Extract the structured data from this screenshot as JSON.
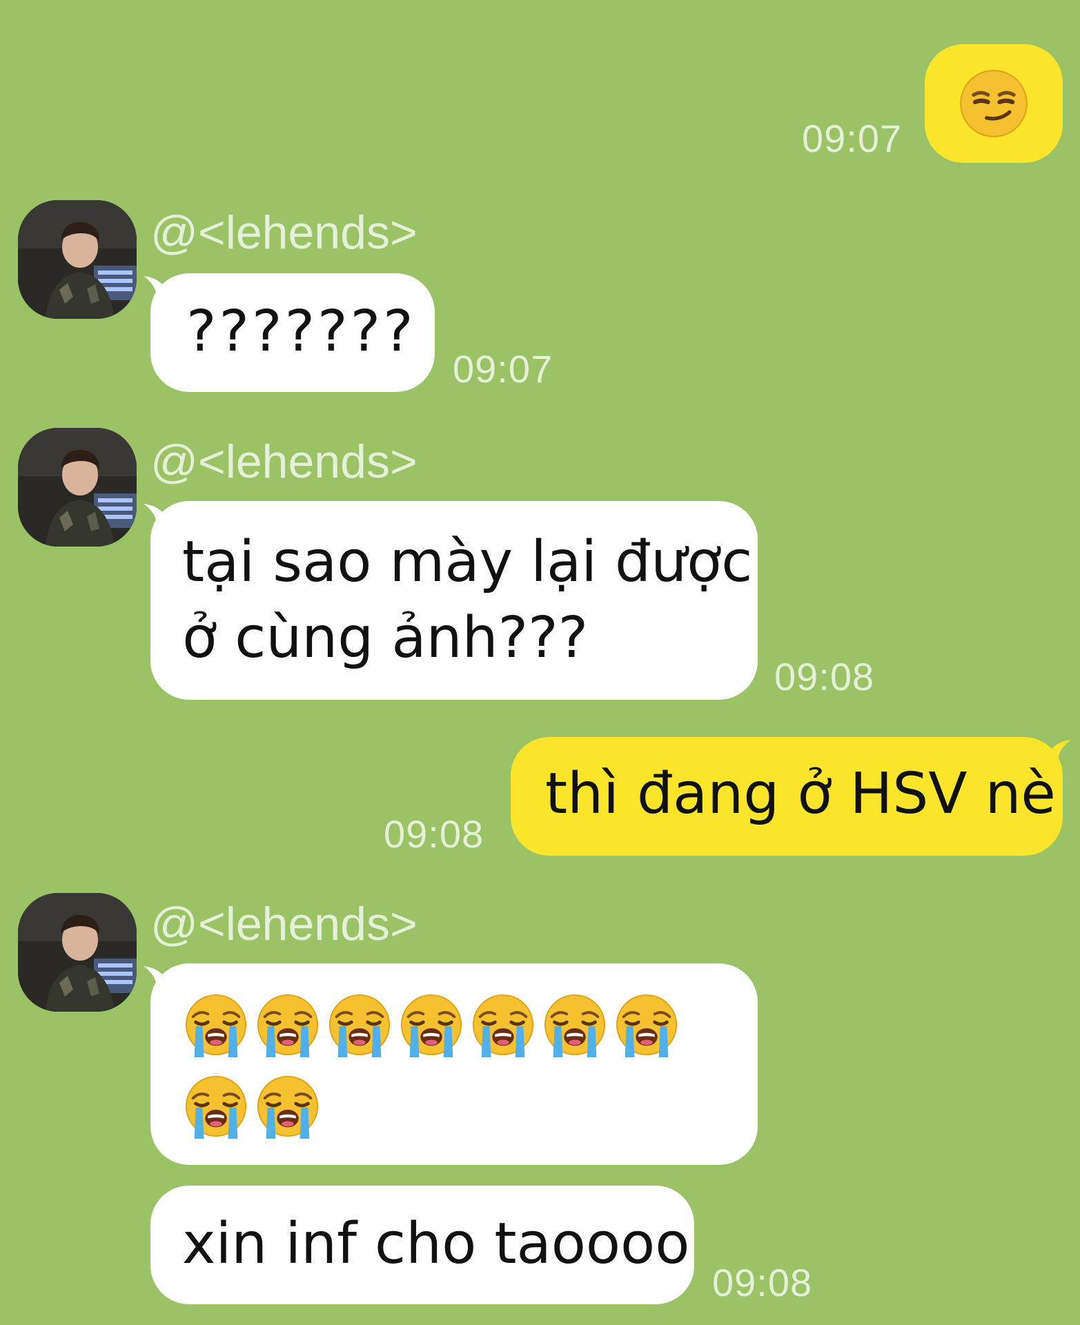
{
  "chat": {
    "messages": [
      {
        "side": "right",
        "emoji": "smirk-face",
        "time": "09:07"
      },
      {
        "side": "left",
        "sender": "@<lehends>",
        "text": "???????",
        "time": "09:07"
      },
      {
        "side": "left",
        "sender": "@<lehends>",
        "lines": [
          "tại sao mày lại được",
          "ở cùng ảnh???"
        ],
        "time": "09:08"
      },
      {
        "side": "right",
        "text": "thì đang ở HSV nè",
        "time": "09:08"
      },
      {
        "side": "left",
        "sender": "@<lehends>",
        "emoji": "loudly-crying-face",
        "emoji_count_row1": 7,
        "emoji_count_row2": 2
      },
      {
        "side": "left",
        "text": "xin inf cho taoooo",
        "time": "09:08"
      }
    ]
  },
  "colors": {
    "background": "#9bc264",
    "incoming_bubble": "#ffffff",
    "outgoing_bubble": "#fbe52a",
    "meta_text": "#e6efd8"
  }
}
